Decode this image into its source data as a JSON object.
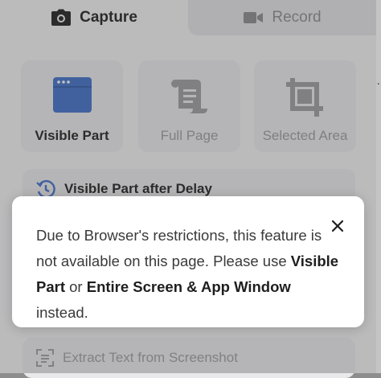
{
  "tabs": {
    "capture_label": "Capture",
    "record_label": "Record"
  },
  "capture_options": [
    {
      "label": "Visible Part",
      "icon": "browser-window-icon",
      "enabled": true
    },
    {
      "label": "Full Page",
      "icon": "scroll-page-icon",
      "enabled": false
    },
    {
      "label": "Selected Area",
      "icon": "crop-icon",
      "enabled": false
    }
  ],
  "rows": {
    "delay_label": "Visible Part after Delay",
    "extract_label": "Extract Text from Screenshot"
  },
  "dialog": {
    "text_1": "Due to Browser's restrictions, this feature is not available on this page. Please use ",
    "link_1": "Visible Part",
    "text_2": " or ",
    "link_2": "Entire Screen & App Window",
    "text_3": " instead.",
    "close_icon": "close-icon"
  },
  "edge_mark": "·",
  "colors": {
    "accent_blue": "#3f6ec8",
    "disabled_icon": "#9b9b9e",
    "dark_icon": "#1e1e1e"
  }
}
